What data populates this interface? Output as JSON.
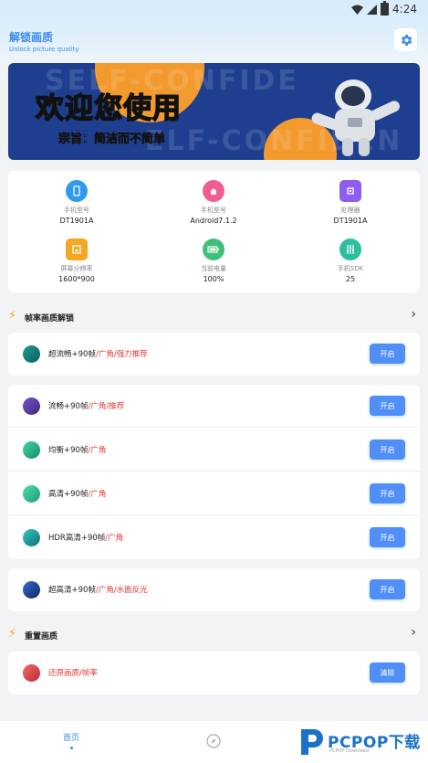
{
  "status_bar": {
    "time": "4:24"
  },
  "header": {
    "title": "解锁画质",
    "subtitle": "Unlock picture quality",
    "settings_icon": "gear-icon"
  },
  "banner": {
    "headline": "欢迎您使用",
    "tagline": "宗旨：简洁而不简单",
    "background_text": "SELF-CONFIDE",
    "background_text_2": "ELF-CONFIDEN"
  },
  "device_info": [
    {
      "label": "手机型号",
      "value": "DT1901A",
      "icon": "phone-icon",
      "color": "#2f9bf0"
    },
    {
      "label": "手机型号",
      "value": "Android7.1.2",
      "icon": "android-icon",
      "color": "#ef5f8d"
    },
    {
      "label": "处理器",
      "value": "DT1901A",
      "icon": "cpu-icon",
      "color": "#8e5df0"
    },
    {
      "label": "屏幕分辨率",
      "value": "1600*900",
      "icon": "screen-icon",
      "color": "#f5a623"
    },
    {
      "label": "当前电量",
      "value": "100%",
      "icon": "battery-icon",
      "color": "#3fc07a"
    },
    {
      "label": "手机SDK",
      "value": "25",
      "icon": "sliders-icon",
      "color": "#2bbfa0"
    }
  ],
  "section_fps": {
    "title": "帧率画质解锁"
  },
  "fps_groups": [
    [
      {
        "name": "超流畅+90帧",
        "extra": "/广角/强力推荐",
        "button": "开启",
        "color": "#1f9c8f"
      }
    ],
    [
      {
        "name": "流畅+90帧",
        "extra": "/广角/推荐",
        "button": "开启",
        "color": "#5b3fb0"
      },
      {
        "name": "均衡+90帧",
        "extra": "/广角",
        "button": "开启",
        "color": "#23b58a"
      },
      {
        "name": "高清+90帧",
        "extra": "/广角",
        "button": "开启",
        "color": "#2fc18f"
      },
      {
        "name": "HDR高清+90帧",
        "extra": "/广角",
        "button": "开启",
        "color": "#1fa6a0"
      }
    ],
    [
      {
        "name": "超高清+90帧",
        "extra": "/广角/水面反光",
        "button": "开启",
        "color": "#1a3f8f"
      }
    ]
  ],
  "section_reset": {
    "title": "重置画质"
  },
  "reset_row": {
    "name": "还原画质/帧率",
    "button": "清除",
    "color": "#e8474c"
  },
  "nav": {
    "home_label": "首页"
  },
  "watermark": {
    "brand": "PCPOP下载",
    "sub": "PCPOP Download"
  }
}
